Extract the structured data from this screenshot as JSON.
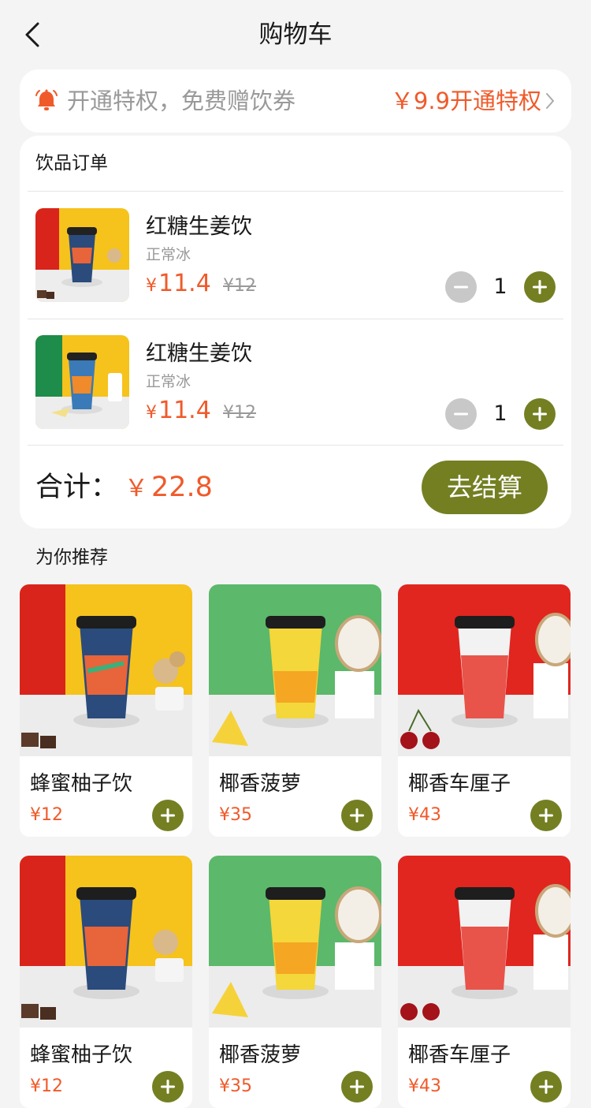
{
  "nav": {
    "title": "购物车"
  },
  "vip_banner": {
    "text": "开通特权，免费赠饮券",
    "cta": "￥9.9开通特权"
  },
  "orders": {
    "heading": "饮品订单",
    "items": [
      {
        "name": "红糖生姜饮",
        "spec": "正常冰",
        "currency": "¥",
        "price": "11.4",
        "original_price": "¥12",
        "qty": "1"
      },
      {
        "name": "红糖生姜饮",
        "spec": "正常冰",
        "currency": "¥",
        "price": "11.4",
        "original_price": "¥12",
        "qty": "1"
      }
    ],
    "total_label": "合计：",
    "total_currency": "￥",
    "total_amount": "22.8",
    "checkout_label": "去结算"
  },
  "recommend": {
    "heading": "为你推荐",
    "products": [
      {
        "name": "蜂蜜柚子饮",
        "price": "¥12"
      },
      {
        "name": "椰香菠萝",
        "price": "¥35"
      },
      {
        "name": "椰香车厘子",
        "price": "¥43"
      },
      {
        "name": "蜂蜜柚子饮",
        "price": "¥12"
      },
      {
        "name": "椰香菠萝",
        "price": "¥35"
      },
      {
        "name": "椰香车厘子",
        "price": "¥43"
      }
    ]
  },
  "colors": {
    "accent_price": "#f05a2a",
    "button_olive": "#747f22",
    "page_bg": "#f4f4f4"
  },
  "icons": {
    "back": "chevron-left-icon",
    "bell": "bell-icon",
    "minus": "minus-icon",
    "plus": "plus-icon"
  }
}
